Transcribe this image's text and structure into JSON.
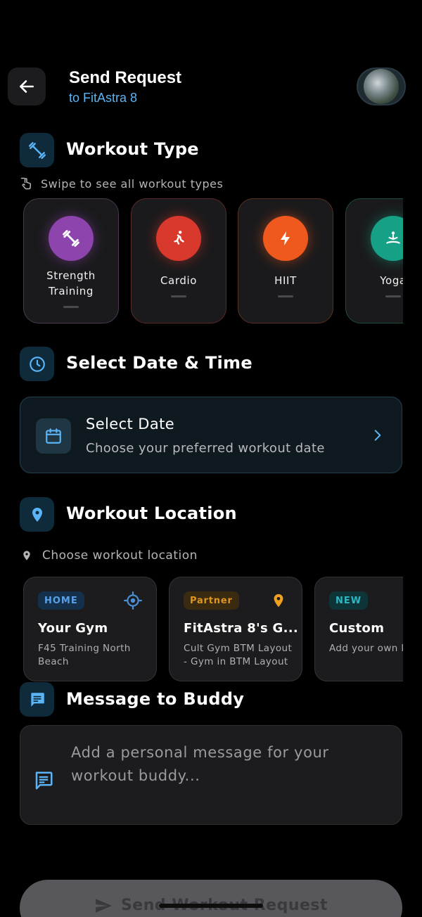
{
  "header": {
    "title": "Send Request",
    "subtitle": "to FitAstra 8"
  },
  "workout_type": {
    "title": "Workout Type",
    "hint": "Swipe to see all workout types",
    "types": [
      {
        "label_line1": "Strength",
        "label_line2": "Training",
        "icon": "dumbbell-icon",
        "color": "#8e44ad"
      },
      {
        "label_line1": "Cardio",
        "label_line2": "",
        "icon": "running-icon",
        "color": "#d9382c"
      },
      {
        "label_line1": "HIIT",
        "label_line2": "",
        "icon": "lightning-icon",
        "color": "#f0591e"
      },
      {
        "label_line1": "Yoga",
        "label_line2": "",
        "icon": "meditation-icon",
        "color": "#16a085"
      }
    ]
  },
  "date_time": {
    "title": "Select Date & Time",
    "card_title": "Select Date",
    "card_subtitle": "Choose your preferred workout date"
  },
  "location": {
    "title": "Workout Location",
    "hint": "Choose workout location",
    "cards": [
      {
        "badge": "HOME",
        "name": "Your Gym",
        "desc": "F45 Training North Beach",
        "badge_color": "#4a90d9",
        "icon": "target-location-icon"
      },
      {
        "badge": "Partner",
        "name": "FitAstra 8's G...",
        "desc": "Cult Gym BTM Layout - Gym in BTM Layout",
        "badge_color": "#e09420",
        "icon": "map-pin-icon"
      },
      {
        "badge": "NEW",
        "name": "Custom",
        "desc": "Add your own location",
        "badge_color": "#2fb6c4",
        "icon": ""
      }
    ]
  },
  "message": {
    "title": "Message to Buddy",
    "placeholder": "Add a personal message for your workout buddy..."
  },
  "send_button": {
    "label": "Send Workout Request"
  },
  "colors": {
    "accent": "#5ab4f5",
    "background": "#000000"
  }
}
